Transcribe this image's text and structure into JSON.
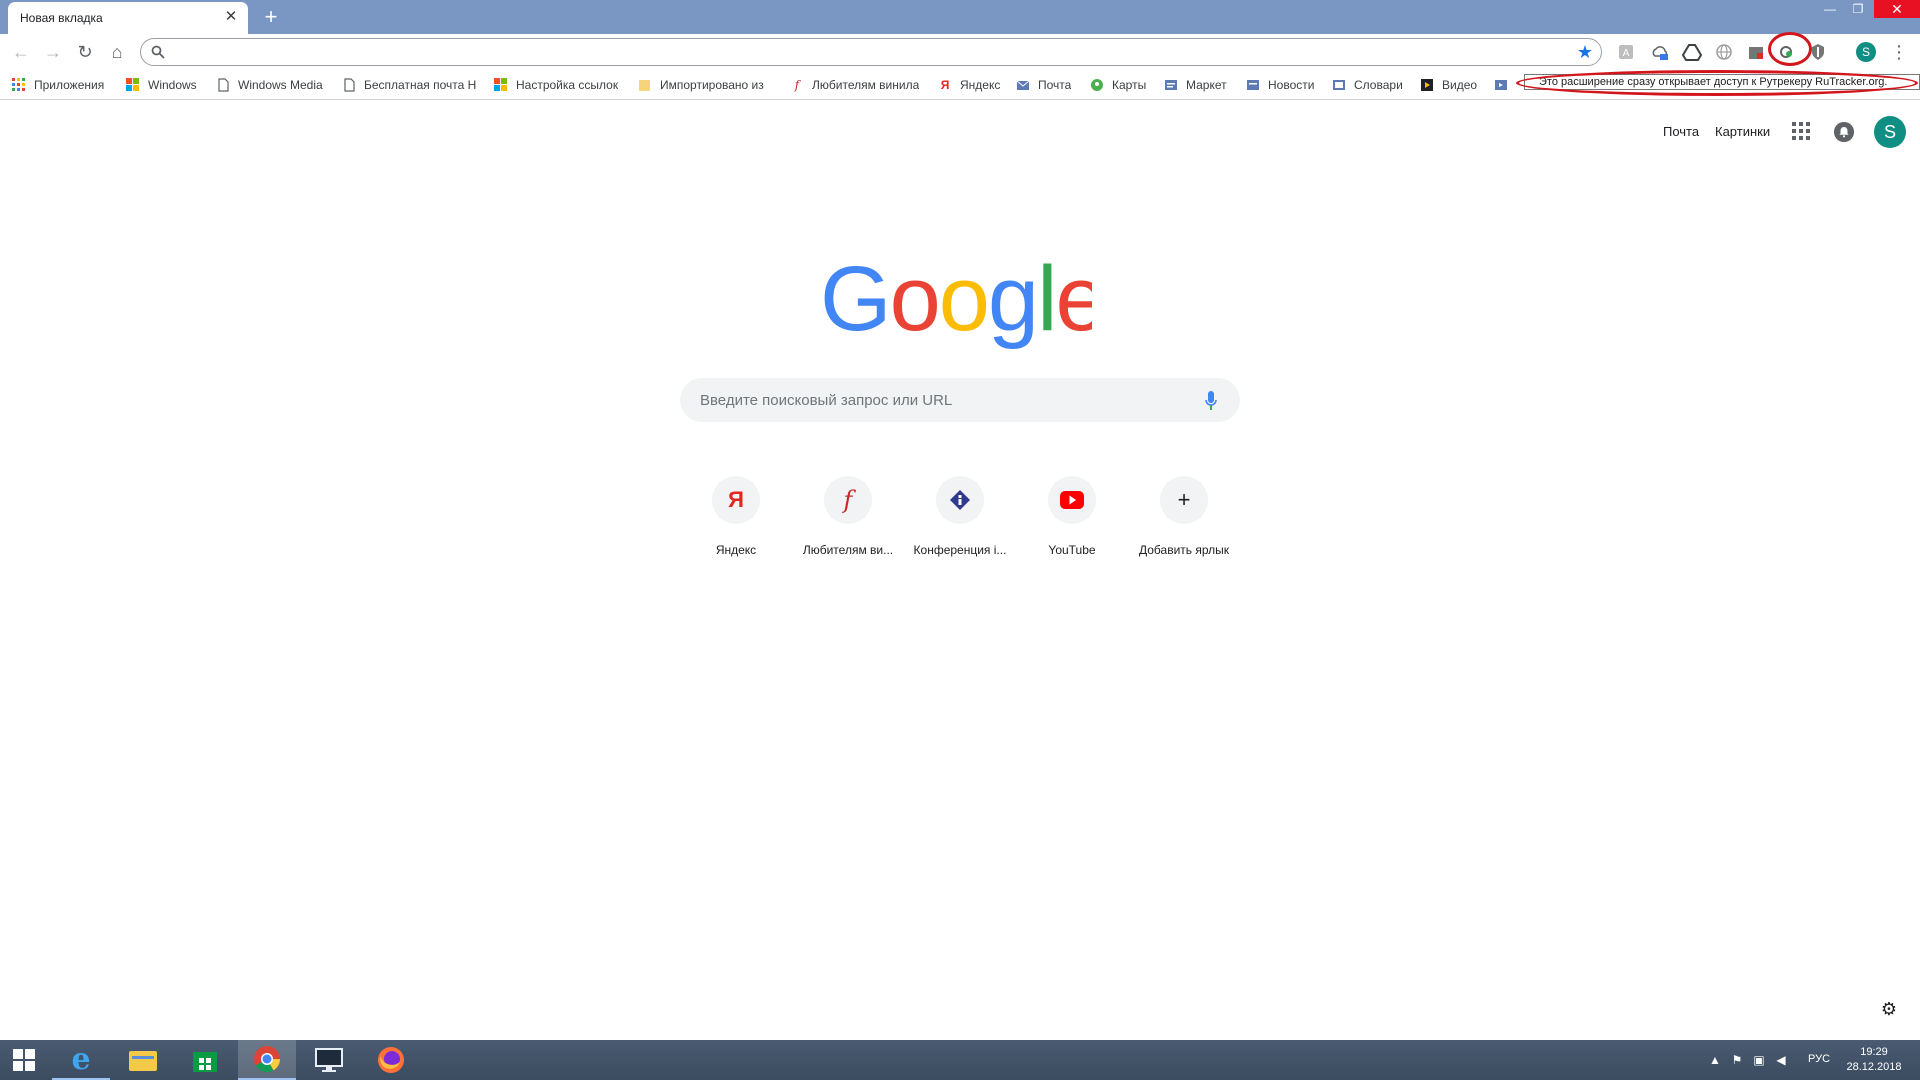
{
  "browser": {
    "tab": {
      "title": "Новая вкладка"
    },
    "omnibox": {
      "value": "",
      "placeholder": ""
    }
  },
  "bookmarks": [
    {
      "label": "Приложения",
      "icon": "apps-grid-icon"
    },
    {
      "label": "Windows",
      "icon": "windows-icon"
    },
    {
      "label": "Windows Media",
      "icon": "page-icon"
    },
    {
      "label": "Бесплатная почта H",
      "icon": "page-icon"
    },
    {
      "label": "Настройка ссылок",
      "icon": "windows-icon"
    },
    {
      "label": "Импортировано из",
      "icon": "folder-icon"
    },
    {
      "label": "Любителям винила",
      "icon": "f-icon"
    },
    {
      "label": "Яндекс",
      "icon": "yandex-icon"
    },
    {
      "label": "Почта",
      "icon": "mail-icon"
    },
    {
      "label": "Карты",
      "icon": "maps-icon"
    },
    {
      "label": "Маркет",
      "icon": "market-icon"
    },
    {
      "label": "Новости",
      "icon": "news-icon"
    },
    {
      "label": "Словари",
      "icon": "dictionary-icon"
    },
    {
      "label": "Видео",
      "icon": "video-icon"
    }
  ],
  "tooltip": {
    "text": "Это расширение сразу открывает доступ к Рутрекеру RuTracker.org."
  },
  "ntp": {
    "mail_link": "Почта",
    "images_link": "Картинки",
    "avatar_letter": "S",
    "search_placeholder": "Введите поисковый запрос или URL",
    "shortcuts": [
      {
        "label": "Яндекс",
        "icon": "yandex-icon"
      },
      {
        "label": "Любителям ви...",
        "icon": "f-icon"
      },
      {
        "label": "Конференция i...",
        "icon": "ixbt-icon"
      },
      {
        "label": "YouTube",
        "icon": "youtube-icon"
      },
      {
        "label": "Добавить ярлык",
        "icon": "plus-icon"
      }
    ]
  },
  "profile": {
    "letter": "S"
  },
  "taskbar": {
    "language": "РУС",
    "time": "19:29",
    "date": "28.12.2018"
  },
  "colors": {
    "accent": "#1a73e8",
    "annotation": "#d3151c",
    "google_blue": "#4285f4",
    "google_red": "#ea4335",
    "google_yellow": "#fbbc05",
    "google_green": "#34a853"
  }
}
